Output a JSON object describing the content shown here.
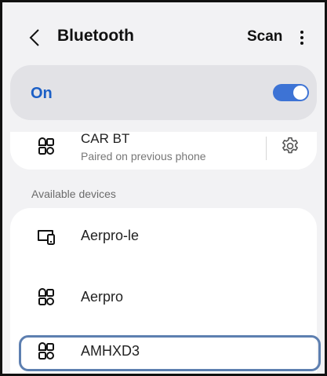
{
  "header": {
    "title": "Bluetooth",
    "scan_label": "Scan",
    "back_icon": "chevron-left-icon",
    "more_icon": "more-vertical-icon"
  },
  "toggle_section": {
    "label": "On",
    "enabled": true,
    "accent": "#3d73d5",
    "label_color": "#1b5fc6"
  },
  "paired": {
    "name": "CAR BT",
    "status": "Paired on previous phone",
    "icon": "device-grid-icon",
    "settings_icon": "gear-icon"
  },
  "available": {
    "section_label": "Available devices",
    "devices": [
      {
        "name": "Aerpro-le",
        "icon": "devices-icon"
      },
      {
        "name": "Aerpro",
        "icon": "device-grid-icon"
      },
      {
        "name": "AMHXD3",
        "icon": "device-grid-icon",
        "highlighted": true
      }
    ]
  }
}
